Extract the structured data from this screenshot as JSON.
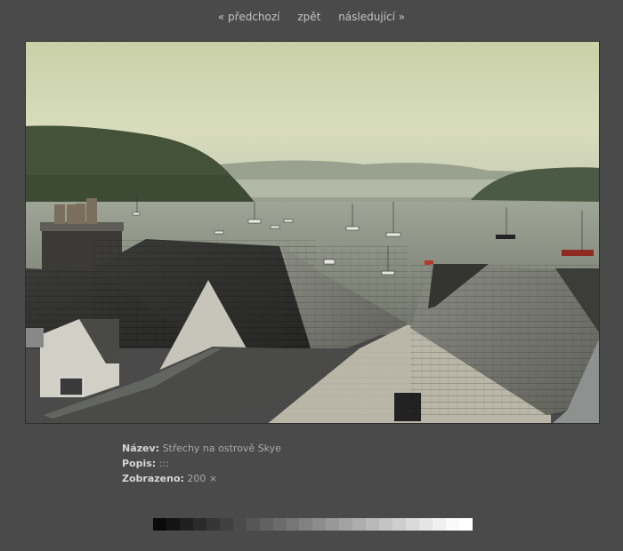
{
  "nav": {
    "prev_label": "« předchozí",
    "back_label": "zpět",
    "next_label": "následující »"
  },
  "photo": {
    "alt": "Střechy na ostrově Skye"
  },
  "meta": {
    "name_label": "Název:",
    "name_value": "Střechy na ostrově Skye",
    "desc_label": "Popis:",
    "desc_value": ":::",
    "views_label": "Zobrazeno:",
    "views_value": "200 ×"
  },
  "swatch_colors": [
    "#0a0a0a",
    "#141414",
    "#1f1f1f",
    "#2a2a2a",
    "#353535",
    "#404040",
    "#4b4b4b",
    "#565656",
    "#616161",
    "#6c6c6c",
    "#777777",
    "#828282",
    "#8d8d8d",
    "#989898",
    "#a3a3a3",
    "#aeaeae",
    "#b9b9b9",
    "#c4c4c4",
    "#cfcfcf",
    "#dadada",
    "#e5e5e5",
    "#f0f0f0",
    "#fafafa",
    "#ffffff"
  ]
}
